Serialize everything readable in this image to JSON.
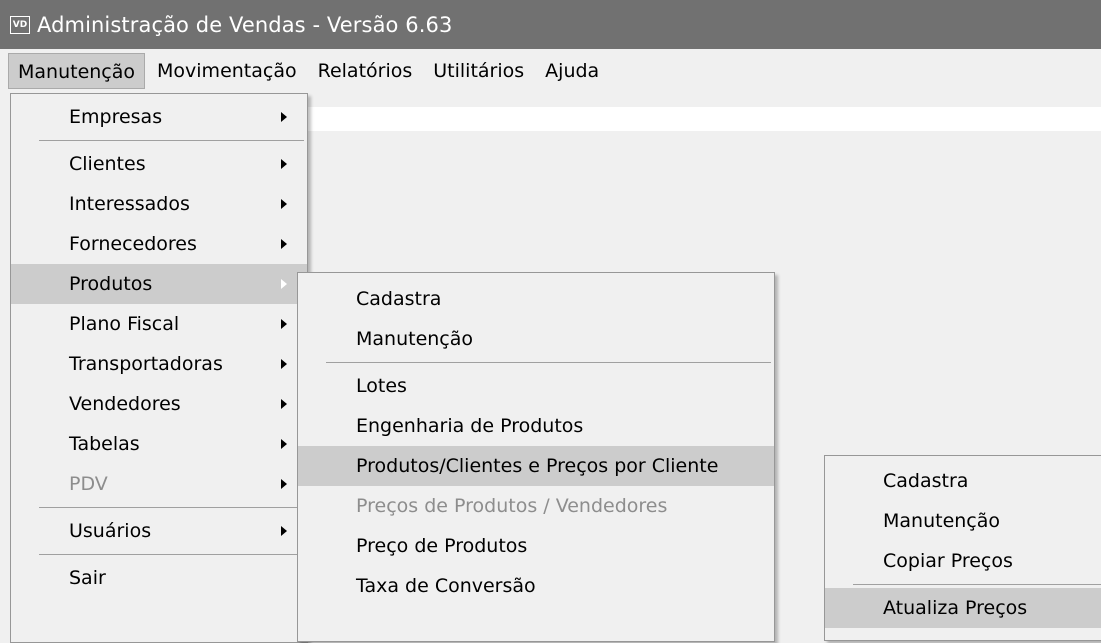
{
  "window": {
    "icon_text": "VD",
    "title": "Administração de Vendas - Versão 6.63"
  },
  "menubar": [
    "Manutenção",
    "Movimentação",
    "Relatórios",
    "Utilitários",
    "Ajuda"
  ],
  "menu_manutencao": [
    "Empresas",
    "Clientes",
    "Interessados",
    "Fornecedores",
    "Produtos",
    "Plano Fiscal",
    "Transportadoras",
    "Vendedores",
    "Tabelas",
    "PDV",
    "Usuários",
    "Sair"
  ],
  "menu_produtos": [
    "Cadastra",
    "Manutenção",
    "Lotes",
    "Engenharia de Produtos",
    "Produtos/Clientes e Preços por Cliente",
    "Preços de Produtos / Vendedores",
    "Preço de Produtos",
    "Taxa de Conversão"
  ],
  "menu_precos_cliente": [
    "Cadastra",
    "Manutenção",
    "Copiar Preços",
    "Atualiza Preços"
  ]
}
